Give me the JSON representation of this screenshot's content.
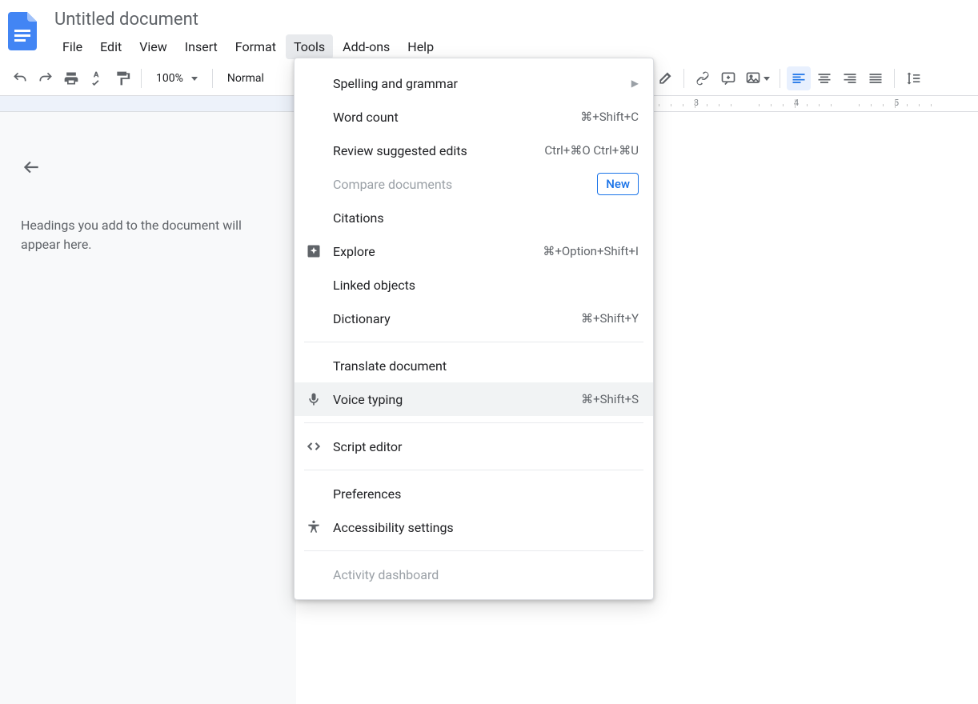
{
  "header": {
    "title": "Untitled document",
    "menus": [
      "File",
      "Edit",
      "View",
      "Insert",
      "Format",
      "Tools",
      "Add-ons",
      "Help"
    ],
    "active_menu_index": 5
  },
  "toolbar": {
    "zoom": "100%",
    "style": "Normal"
  },
  "ruler": {
    "numbers": [
      3,
      4,
      5
    ]
  },
  "outline": {
    "hint": "Headings you add to the document will appear here."
  },
  "tools_menu": {
    "items": [
      {
        "label": "Spelling and grammar",
        "icon": "",
        "right": "submenu"
      },
      {
        "label": "Word count",
        "icon": "",
        "right_text": "⌘+Shift+C"
      },
      {
        "label": "Review suggested edits",
        "icon": "",
        "right_text": "Ctrl+⌘O Ctrl+⌘U"
      },
      {
        "label": "Compare documents",
        "icon": "",
        "disabled": true,
        "badge": "New"
      },
      {
        "label": "Citations",
        "icon": ""
      },
      {
        "label": "Explore",
        "icon": "explore",
        "right_text": "⌘+Option+Shift+I"
      },
      {
        "label": "Linked objects",
        "icon": ""
      },
      {
        "label": "Dictionary",
        "icon": "",
        "right_text": "⌘+Shift+Y"
      },
      {
        "sep": true
      },
      {
        "label": "Translate document",
        "icon": ""
      },
      {
        "label": "Voice typing",
        "icon": "mic",
        "right_text": "⌘+Shift+S",
        "hovered": true
      },
      {
        "sep": true
      },
      {
        "label": "Script editor",
        "icon": "code"
      },
      {
        "sep": true
      },
      {
        "label": "Preferences",
        "icon": ""
      },
      {
        "label": "Accessibility settings",
        "icon": "accessibility"
      },
      {
        "sep": true
      },
      {
        "label": "Activity dashboard",
        "icon": "",
        "disabled": true
      }
    ]
  }
}
